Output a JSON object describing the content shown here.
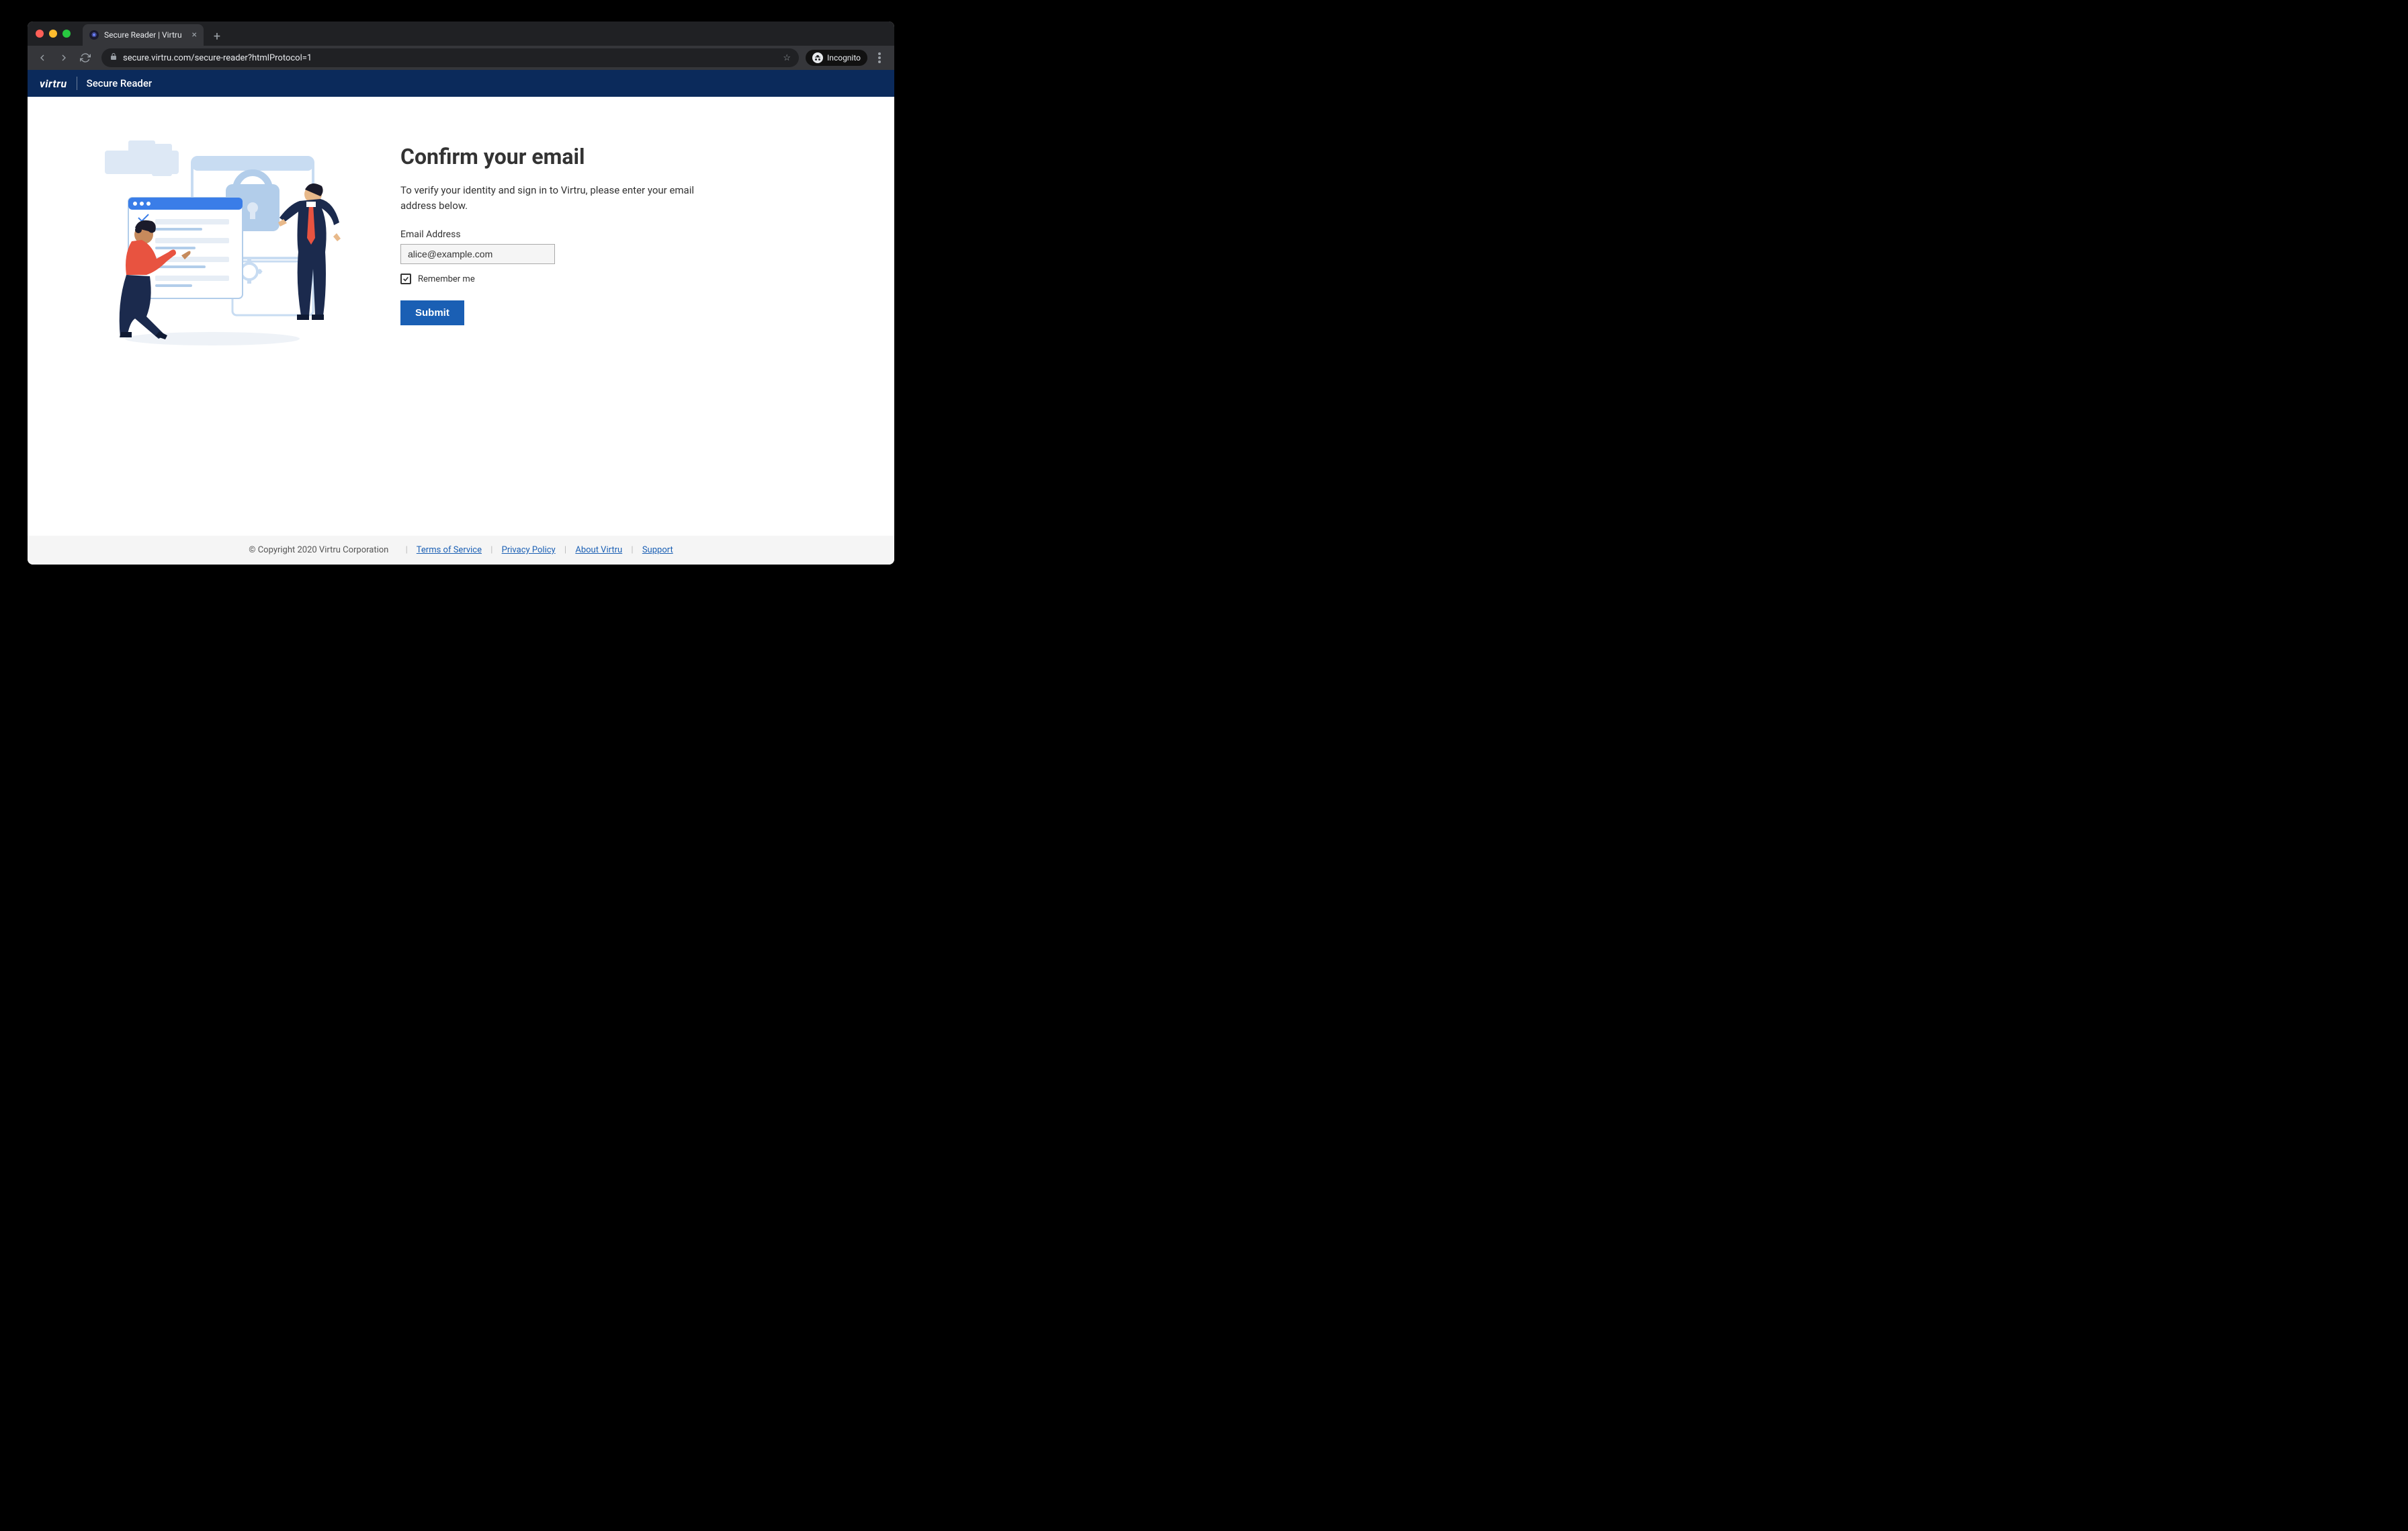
{
  "browser": {
    "tab_title": "Secure Reader | Virtru",
    "url": "secure.virtru.com/secure-reader?htmlProtocol=1",
    "incognito_label": "Incognito"
  },
  "header": {
    "logo_text": "virtru",
    "app_title": "Secure Reader"
  },
  "form": {
    "heading": "Confirm your email",
    "description": "To verify your identity and sign in to Virtru, please enter your email address below.",
    "email_label": "Email Address",
    "email_value": "alice@example.com",
    "remember_label": "Remember me",
    "remember_checked": true,
    "submit_label": "Submit"
  },
  "footer": {
    "copyright": "© Copyright 2020 Virtru Corporation",
    "links": {
      "terms": "Terms of Service",
      "privacy": "Privacy Policy",
      "about": "About Virtru",
      "support": "Support"
    }
  }
}
